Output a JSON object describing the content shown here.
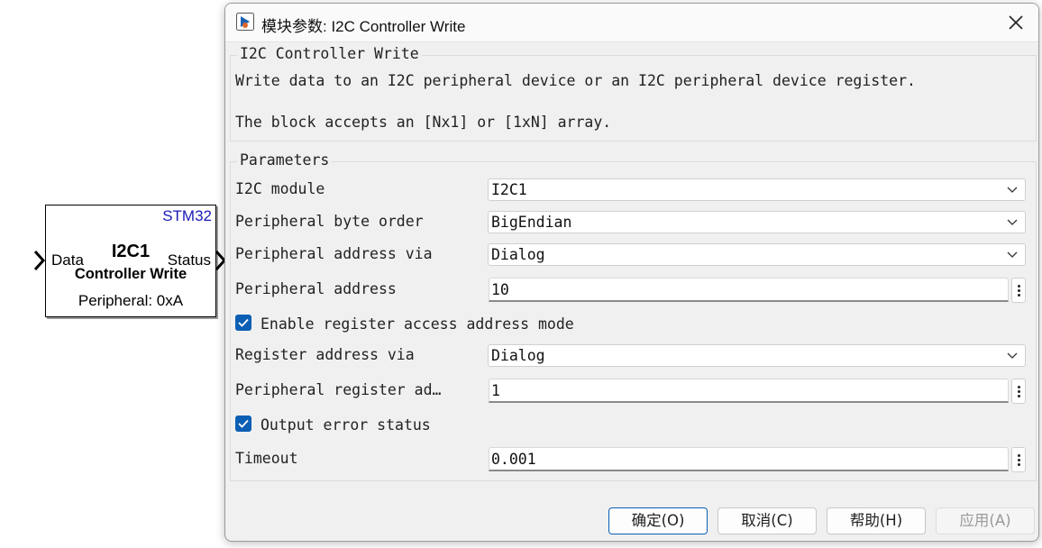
{
  "block": {
    "brand": "STM32",
    "title_line1": "I2C1",
    "title_line2": "Controller Write",
    "input_port": "Data",
    "output_port": "Status",
    "subtitle": "Peripheral: 0xA"
  },
  "dialog": {
    "title": "模块参数: I2C Controller Write",
    "description": {
      "heading": "I2C Controller Write",
      "line1": "Write data to an I2C peripheral device or an I2C peripheral device register.",
      "line2": "The block accepts an [Nx1] or [1xN] array."
    },
    "parameters": {
      "heading": "Parameters",
      "i2c_module": {
        "label": "I2C module",
        "value": "I2C1"
      },
      "byte_order": {
        "label": "Peripheral byte order",
        "value": "BigEndian"
      },
      "address_via": {
        "label": "Peripheral address via",
        "value": "Dialog"
      },
      "peripheral_address": {
        "label": "Peripheral address",
        "value": "10"
      },
      "enable_register": {
        "label": "Enable register access address mode",
        "checked": true
      },
      "register_via": {
        "label": "Register address via",
        "value": "Dialog"
      },
      "register_address": {
        "label": "Peripheral register ad…",
        "value": "1"
      },
      "output_error": {
        "label": "Output error status",
        "checked": true
      },
      "timeout": {
        "label": "Timeout",
        "value": "0.001"
      }
    },
    "buttons": {
      "ok": "确定(O)",
      "cancel": "取消(C)",
      "help": "帮助(H)",
      "apply": "应用(A)"
    }
  },
  "icons": {
    "app": "simulink-block-icon",
    "close": "close-icon",
    "dropdown": "chevron-down-icon",
    "more": "more-vertical-icon",
    "check": "checkmark-icon"
  },
  "colors": {
    "accent": "#0a5fb4",
    "brand_text": "#1a1ab8"
  }
}
